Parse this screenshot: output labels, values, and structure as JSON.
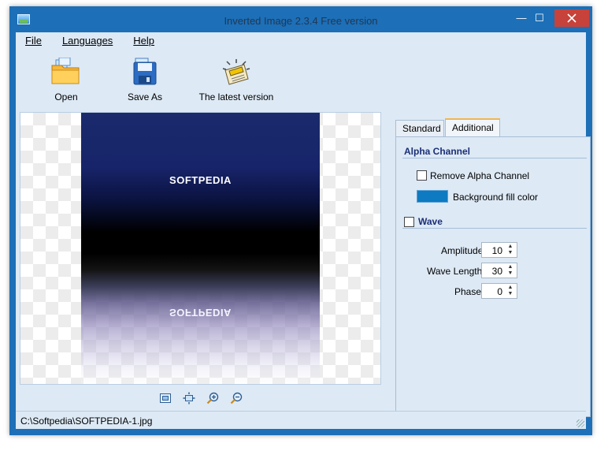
{
  "window": {
    "title": "Inverted Image 2.3.4 Free version",
    "minimize_glyph": "—",
    "maximize_glyph": "☐"
  },
  "menu": {
    "items": [
      "File",
      "Languages",
      "Help"
    ]
  },
  "toolbar": {
    "open_label": "Open",
    "save_label": "Save As",
    "latest_label": "The latest version"
  },
  "image": {
    "text_top": "SOFTPEDIA",
    "text_bottom": "SOFTPEDIA"
  },
  "tabs": {
    "standard": "Standard",
    "additional": "Additional"
  },
  "additional": {
    "alpha_channel_title": "Alpha Channel",
    "remove_alpha_label": "Remove Alpha Channel",
    "remove_alpha_checked": false,
    "background_fill_label": "Background fill color",
    "background_fill_color": "#0d7ac1",
    "wave_title": "Wave",
    "wave_checked": false,
    "amplitude_label": "Amplitude",
    "amplitude_value": "10",
    "wave_length_label": "Wave Length",
    "wave_length_value": "30",
    "phase_label": "Phase",
    "phase_value": "0"
  },
  "status": {
    "path": "C:\\Softpedia\\SOFTPEDIA-1.jpg"
  },
  "icons": {
    "open": "folder-icon",
    "save": "floppy-icon",
    "latest": "extra-newspaper-icon",
    "zoom": [
      "fit-icon",
      "actual-size-icon",
      "zoom-in-icon",
      "zoom-out-icon"
    ]
  }
}
